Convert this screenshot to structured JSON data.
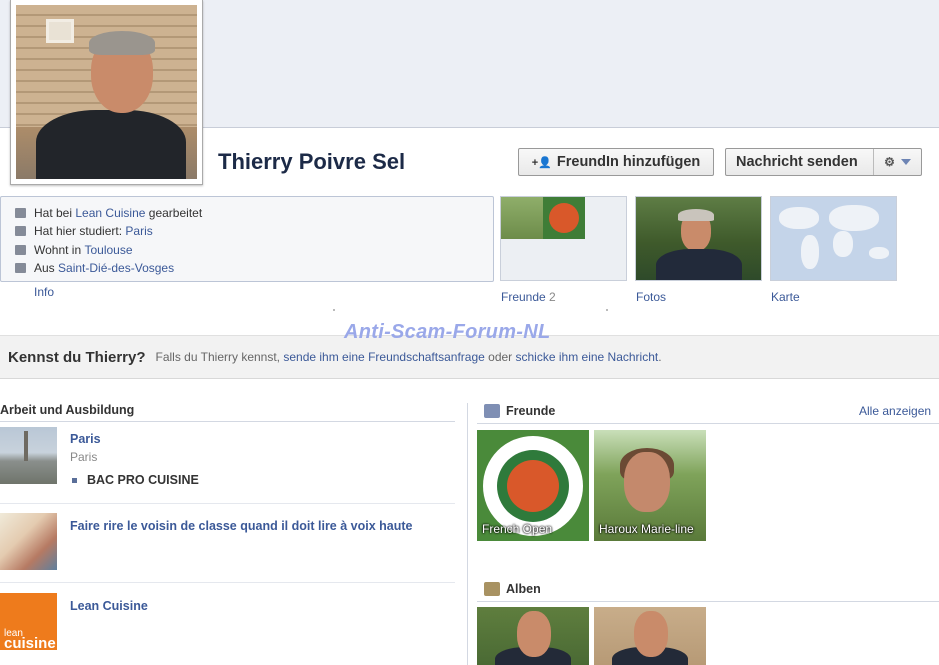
{
  "profile": {
    "name": "Thierry Poivre Sel",
    "add_friend_label": "FreundIn hinzufügen",
    "send_message_label": "Nachricht senden"
  },
  "info": {
    "worked_prefix": "Hat bei ",
    "worked_link": "Lean Cuisine",
    "worked_suffix": " gearbeitet",
    "studied_prefix": "Hat hier studiert: ",
    "studied_link": "Paris",
    "lives_prefix": "Wohnt in ",
    "lives_link": "Toulouse",
    "from_prefix": "Aus ",
    "from_link": "Saint-Dié-des-Vosges",
    "tab_label": "Info"
  },
  "thumbs": {
    "friends_label": "Freunde",
    "friends_count": "2",
    "photos_label": "Fotos",
    "map_label": "Karte"
  },
  "watermark": "Anti-Scam-Forum-NL",
  "know_bar": {
    "question": "Kennst du Thierry?",
    "text_1": "Falls du Thierry kennst, ",
    "link_1": "sende ihm eine Freundschaftsanfrage",
    "text_2": " oder ",
    "link_2": "schicke ihm eine Nachricht",
    "text_3": "."
  },
  "work": {
    "heading": "Arbeit und Ausbildung",
    "items": [
      {
        "title": "Paris",
        "subtitle": "Paris",
        "bullet": "BAC PRO CUISINE"
      },
      {
        "title": "Faire rire le voisin de classe quand il doit lire à voix haute"
      },
      {
        "title": "Lean Cuisine",
        "logo_text_1": "lean",
        "logo_text_2": "cuisine"
      }
    ]
  },
  "friends_section": {
    "heading": "Freunde",
    "see_all": "Alle anzeigen",
    "items": [
      {
        "name": "French Open"
      },
      {
        "name": "Haroux Marie-line"
      }
    ]
  },
  "albums_section": {
    "heading": "Alben"
  },
  "colors": {
    "link": "#3b5998",
    "name": "#1c2a47",
    "watermark": "#9aa8e9"
  }
}
